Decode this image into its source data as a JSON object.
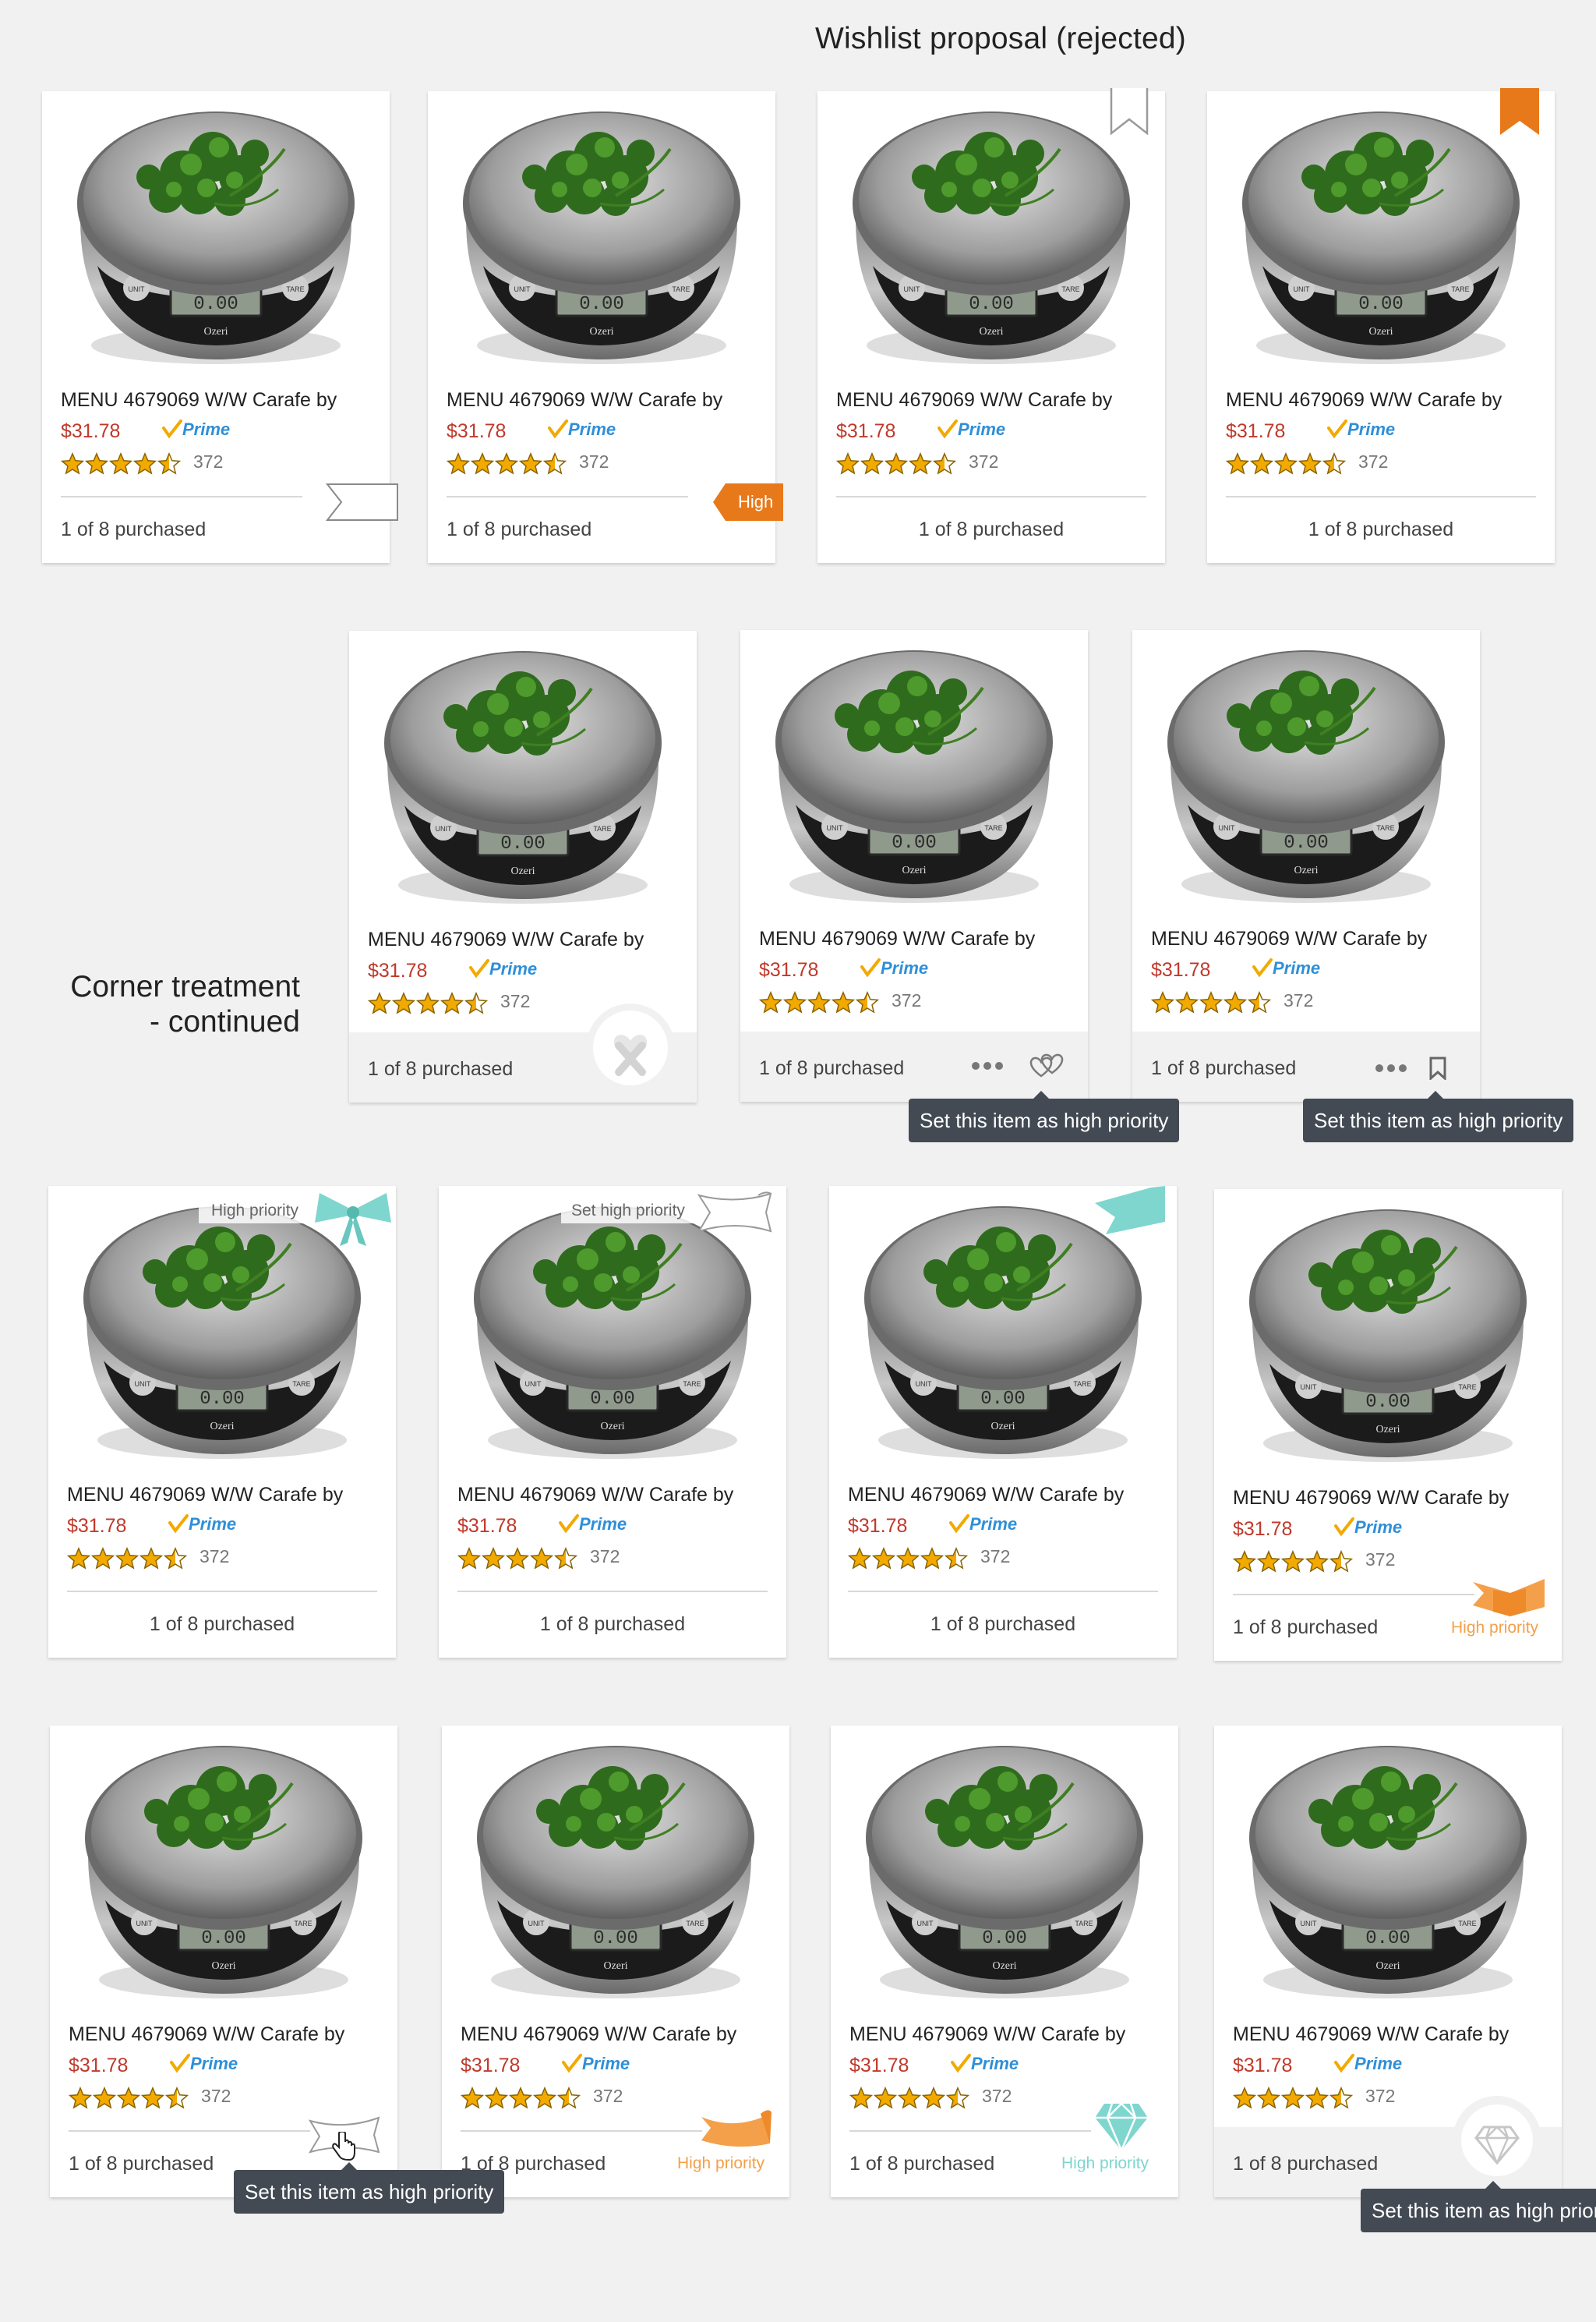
{
  "page": {
    "title": "Wishlist proposal (rejected)",
    "side_label_line1": "Corner treatment",
    "side_label_line2": "- continued"
  },
  "product": {
    "title": "MENU 4679069 W/W Carafe by",
    "price": "$31.78",
    "rating": 4.5,
    "reviews": "372",
    "purchased": "1 of 8 purchased",
    "prime_label": "Prime",
    "scale_brand": "Ozeri",
    "scale_button_left": "UNIT",
    "scale_button_right": "TARE"
  },
  "labels": {
    "high": "High",
    "high_priority": "High priority",
    "set_high_priority": "Set high priority",
    "tooltip": "Set this item as high priority"
  },
  "colors": {
    "accent_orange": "#e8791a",
    "ribbon_orange": "#f4a04a",
    "teal": "#7fd6cf",
    "price_red": "#c0392b",
    "prime_blue": "#2f8fd8",
    "star_gold": "#f2a900",
    "tooltip_bg": "#434a54"
  },
  "icons": [
    "thumbnail-scale-image",
    "prime-logo",
    "star-icon",
    "flag-outline-icon",
    "bookmark-outline-icon",
    "bookmark-filled-icon",
    "heart-ribbon-icon",
    "hearts-icon",
    "more-dots-icon",
    "bow-icon",
    "scroll-ribbon-icon",
    "teal-ribbon-icon",
    "diamond-icon",
    "hand-cursor-icon"
  ]
}
